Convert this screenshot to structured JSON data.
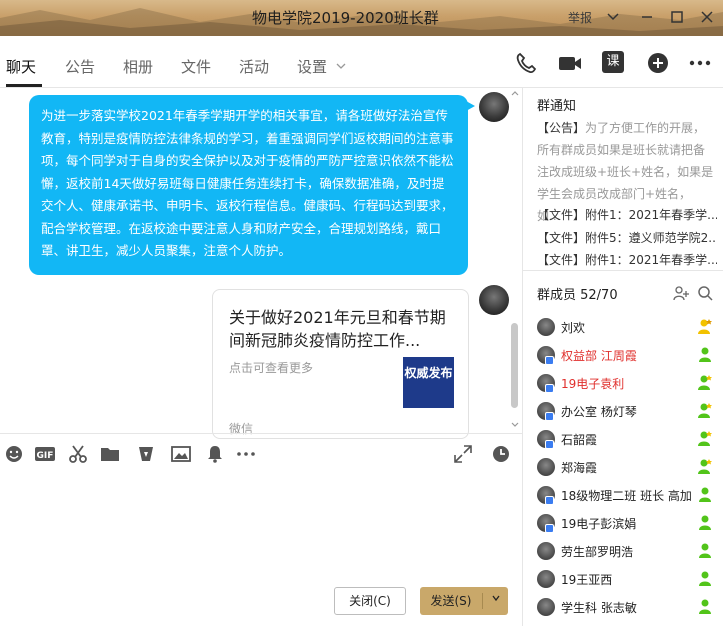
{
  "window": {
    "title": "物电学院2019-2020班长群",
    "report_label": "举报"
  },
  "tabs": [
    {
      "label": "聊天",
      "active": true
    },
    {
      "label": "公告"
    },
    {
      "label": "相册"
    },
    {
      "label": "文件"
    },
    {
      "label": "活动"
    },
    {
      "label": "设置"
    }
  ],
  "header_actions": {
    "course_label": "课"
  },
  "chat": {
    "messages": [
      {
        "type": "text",
        "text": "为进一步落实学校2021年春季学期开学的相关事宜，请各班做好法治宣传教育，特别是疫情防控法律条规的学习，着重强调同学们返校期间的注意事项，每个同学对于自身的安全保护以及对于疫情的严防严控意识依然不能松懈，返校前14天做好易班每日健康任务连续打卡，确保数据准确，及时提交个人、健康承诺书、申明卡、返校行程信息。健康码、行程码达到要求，配合学校管理。在返校途中要注意人身和财产安全，合理规划路线，戴口罩、讲卫生，减少人员聚集，注意个人防护。"
      },
      {
        "type": "card",
        "title": "关于做好2021年元旦和春节期间新冠肺炎疫情防控工作...",
        "subtitle": "点击可查看更多",
        "thumb_text": "权威发布",
        "source": "微信"
      }
    ]
  },
  "composer": {
    "close_label": "关闭(C)",
    "send_label": "发送(S)"
  },
  "group_notice": {
    "title": "群通知",
    "tag": "【公告】",
    "text": "为了方便工作的开展，所有群成员如果是班长就请把备注改成班级+班长+姓名，如果是学生会成员改成部门+姓名，如...",
    "files": [
      "【文件】附件1：2021年春季学...",
      "【文件】附件5：遵义师范学院2...",
      "【文件】附件1：2021年春季学..."
    ]
  },
  "members": {
    "title": "群成员 52/70",
    "list": [
      {
        "name": "刘欢",
        "red": false,
        "badge": false,
        "role": "owner"
      },
      {
        "name": "权益部 江周霞",
        "red": true,
        "badge": true,
        "role": "member"
      },
      {
        "name": "19电子袁利",
        "red": true,
        "badge": true,
        "role": "admin"
      },
      {
        "name": "办公室 杨灯琴",
        "red": false,
        "badge": true,
        "role": "admin"
      },
      {
        "name": "石韶霞",
        "red": false,
        "badge": true,
        "role": "admin"
      },
      {
        "name": "郑海霞",
        "red": false,
        "badge": false,
        "role": "admin"
      },
      {
        "name": "18级物理二班 班长 高加",
        "red": false,
        "badge": true,
        "role": "member"
      },
      {
        "name": "19电子彭滨娟",
        "red": false,
        "badge": true,
        "role": "member"
      },
      {
        "name": "劳生部罗明浩",
        "red": false,
        "badge": false,
        "role": "member"
      },
      {
        "name": "19王亚西",
        "red": false,
        "badge": false,
        "role": "member"
      },
      {
        "name": "学生科 张志敏",
        "red": false,
        "badge": false,
        "role": "member"
      }
    ]
  }
}
